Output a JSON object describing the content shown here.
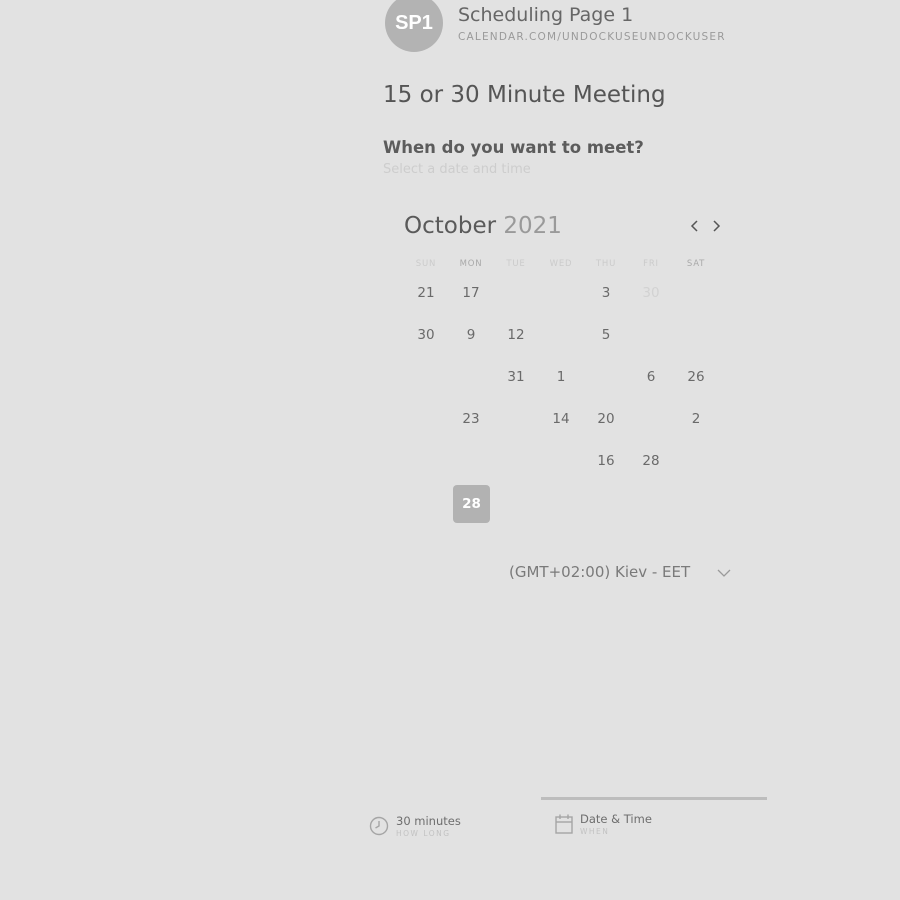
{
  "header": {
    "avatar_initials": "SP1",
    "page_name": "Scheduling Page 1",
    "page_url": "CALENDAR.COM/UNDOCKUSEUNDOCKUSER"
  },
  "meeting": {
    "title": "15 or 30 Minute Meeting",
    "question": "When do you want to meet?",
    "hint": "Select a date and time"
  },
  "calendar": {
    "month": "October",
    "year": "2021",
    "weekdays": [
      "SUN",
      "MON",
      "TUE",
      "WED",
      "THU",
      "FRI",
      "SAT"
    ],
    "selected_day": "28",
    "rows": [
      [
        "21",
        "17",
        "",
        "",
        "3",
        "30",
        ""
      ],
      [
        "30",
        "9",
        "12",
        "",
        "5",
        "",
        ""
      ],
      [
        "",
        "",
        "31",
        "1",
        "",
        "6",
        "26"
      ],
      [
        "",
        "23",
        "",
        "14",
        "20",
        "",
        "2"
      ],
      [
        "",
        "",
        "",
        "",
        "16",
        "28",
        ""
      ],
      [
        "",
        "28",
        "",
        "",
        "",
        "",
        ""
      ]
    ]
  },
  "timezone": {
    "label": "(GMT+02:00) Kiev - EET"
  },
  "steps": {
    "duration_title": "30 minutes",
    "duration_sub": "HOW LONG",
    "datetime_title": "Date & Time",
    "datetime_sub": "WHEN"
  },
  "colors": {
    "background": "#e2e2e2",
    "selected_day": "#b2b2b2",
    "avatar": "#b3b3b3"
  },
  "icons": [
    "clock-icon",
    "calendar-icon",
    "chevron-left-icon",
    "chevron-right-icon",
    "chevron-down-icon"
  ]
}
